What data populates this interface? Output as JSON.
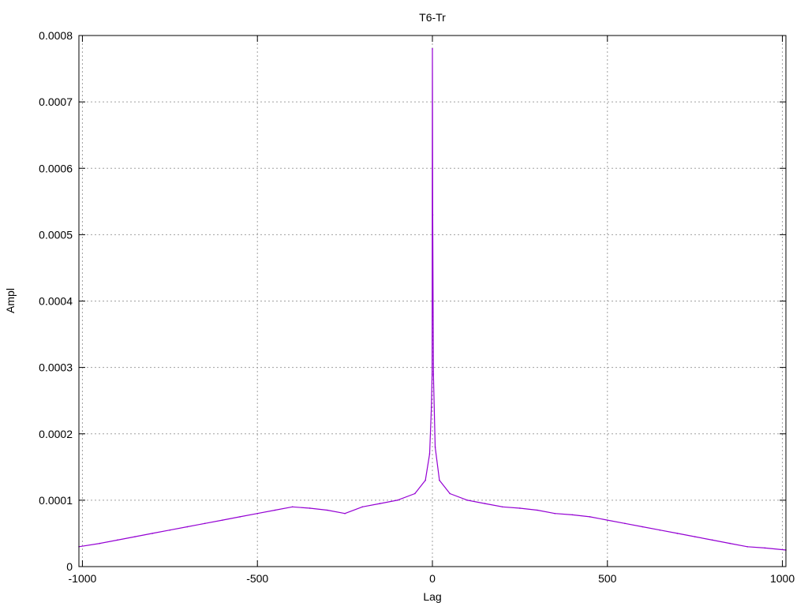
{
  "chart_data": {
    "type": "line",
    "title": "T6-Tr",
    "xlabel": "Lag",
    "ylabel": "Ampl",
    "xlim": [
      -1010,
      1010
    ],
    "ylim": [
      0,
      0.0008
    ],
    "x_ticks": [
      -1000,
      -500,
      0,
      500,
      1000
    ],
    "x_tick_labels": [
      "-1000",
      "-500",
      "0",
      "500",
      "1000"
    ],
    "y_ticks": [
      0,
      0.0001,
      0.0002,
      0.0003,
      0.0004,
      0.0005,
      0.0006,
      0.0007,
      0.0008
    ],
    "y_tick_labels": [
      "0",
      "0.0001",
      "0.0002",
      "0.0003",
      "0.0004",
      "0.0005",
      "0.0006",
      "0.0007",
      "0.0008"
    ],
    "grid": true,
    "legend": "none",
    "series": [
      {
        "color": "#9400d3",
        "x": [
          -1010,
          -950,
          -900,
          -850,
          -800,
          -750,
          -700,
          -650,
          -600,
          -550,
          -500,
          -450,
          -400,
          -350,
          -300,
          -250,
          -200,
          -150,
          -100,
          -50,
          -20,
          -8,
          -3,
          -1,
          0,
          1,
          3,
          8,
          20,
          50,
          100,
          150,
          200,
          250,
          300,
          350,
          400,
          450,
          500,
          550,
          600,
          650,
          700,
          750,
          800,
          850,
          900,
          950,
          1010
        ],
        "y": [
          3e-05,
          3.5e-05,
          4e-05,
          4.5e-05,
          5e-05,
          5.5e-05,
          6e-05,
          6.5e-05,
          7e-05,
          7.5e-05,
          8e-05,
          8.5e-05,
          9e-05,
          8.8e-05,
          8.5e-05,
          8e-05,
          9e-05,
          9.5e-05,
          0.0001,
          0.00011,
          0.00013,
          0.00017,
          0.00024,
          0.00029,
          0.00078,
          0.00053,
          0.00029,
          0.00018,
          0.00013,
          0.00011,
          0.0001,
          9.5e-05,
          9e-05,
          8.8e-05,
          8.5e-05,
          8e-05,
          7.8e-05,
          7.5e-05,
          7e-05,
          6.5e-05,
          6e-05,
          5.5e-05,
          5e-05,
          4.5e-05,
          4e-05,
          3.5e-05,
          3e-05,
          2.8e-05,
          2.5e-05
        ]
      }
    ]
  }
}
